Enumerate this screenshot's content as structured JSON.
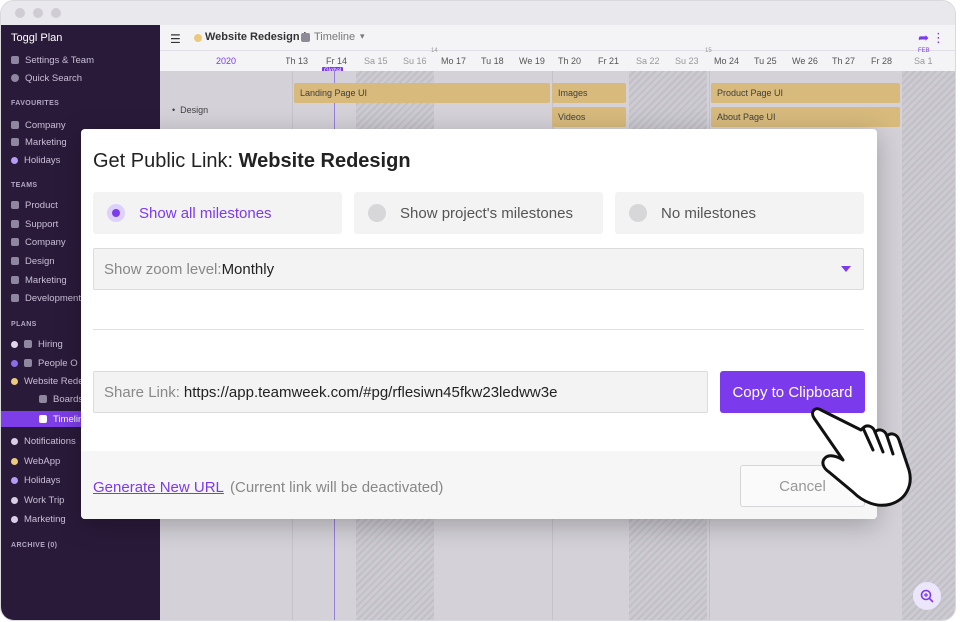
{
  "app": {
    "name": "Toggl Plan",
    "menu": [
      "Settings & Team",
      "Quick Search"
    ]
  },
  "sidebar": {
    "favourites_heading": "FAVOURITES",
    "favourites": [
      "Company",
      "Marketing",
      "Holidays"
    ],
    "teams_heading": "TEAMS",
    "teams": [
      "Product",
      "Support",
      "Company",
      "Design",
      "Marketing",
      "Development"
    ],
    "plans_heading": "PLANS",
    "plans": [
      "Hiring",
      "People O",
      "Website Rede",
      "Boards",
      "Timelin",
      "Notifications",
      "WebApp",
      "Holidays",
      "Work Trip",
      "Marketing"
    ],
    "archive_heading": "ARCHIVE (0)"
  },
  "topbar": {
    "project": "Website Redesign /",
    "view": "Timeline"
  },
  "timeline": {
    "year": "2020",
    "days": [
      "Th 13",
      "Fr 14",
      "Sa 15",
      "Su 16",
      "Mo 17",
      "Tu 18",
      "We 19",
      "Th 20",
      "Fr 21",
      "Sa 22",
      "Su 23",
      "Mo 24",
      "Tu 25",
      "We 26",
      "Th 27",
      "Fr 28",
      "Sa 1"
    ],
    "week_labels": [
      "14",
      "15"
    ],
    "month_label": "FEB",
    "milestone_flag": "Global",
    "group": "Design",
    "bars": [
      "Landing Page UI",
      "Images",
      "Videos",
      "Product Page UI",
      "About Page UI"
    ]
  },
  "modal": {
    "title_prefix": "Get Public Link:",
    "title_project": "Website Redesign",
    "milestone_options": [
      "Show all milestones",
      "Show project's milestones",
      "No milestones"
    ],
    "selected_option": "Show all milestones",
    "zoom_label": "Show zoom level:",
    "zoom_value": "Monthly",
    "share_label": "Share Link:",
    "share_url": "https://app.teamweek.com/#pg/rflesiwn45fkw23ledww3e",
    "copy_button": "Copy to Clipboard",
    "generate_link": "Generate New URL",
    "generate_note": "(Current link will be deactivated)",
    "cancel_button": "Cancel"
  },
  "colors": {
    "accent": "#7c3aed",
    "sidebar_bg": "#2a1a3a",
    "task_bar": "#ecca7c"
  }
}
